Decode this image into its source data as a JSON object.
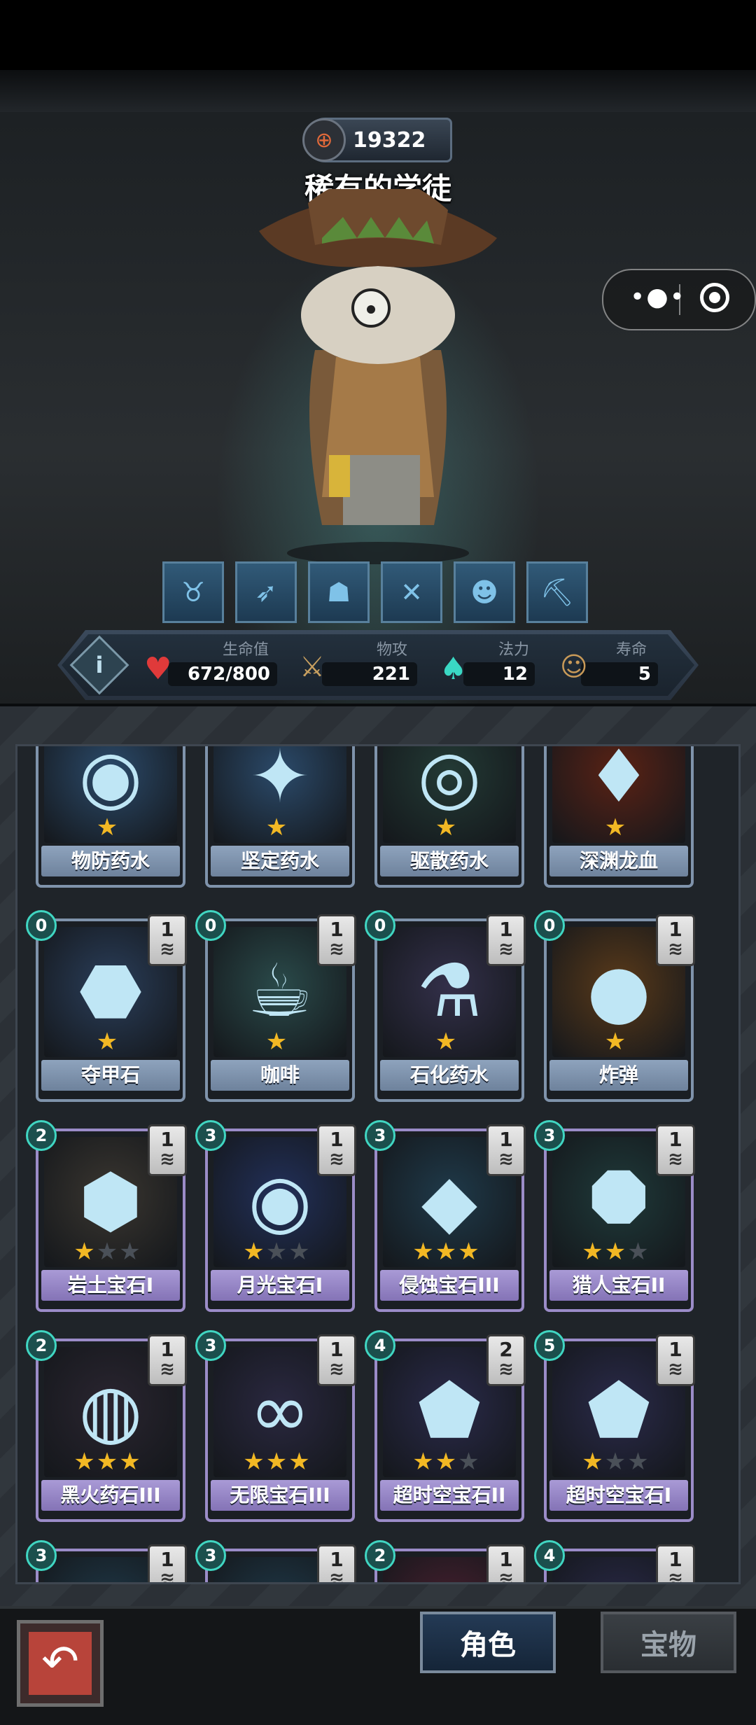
{
  "character": {
    "power": "19322",
    "name": "稀有的学徒"
  },
  "skill_icons": [
    "ox-icon",
    "bow-icon",
    "ghost-icon",
    "crossed-pistols-icon",
    "demon-mask-icon",
    "pickaxe-icon"
  ],
  "stats": {
    "hp_label": "生命值",
    "hp_value": "672/800",
    "atk_label": "物攻",
    "atk_value": "221",
    "mana_label": "法力",
    "mana_value": "12",
    "life_label": "寿命",
    "life_value": "5"
  },
  "cards": [
    {
      "name": "物防药水",
      "cost": "",
      "count": "",
      "stars": 1,
      "max_stars": 1,
      "color": "#2b4a6a",
      "symbol": "◉",
      "tier": "blue"
    },
    {
      "name": "坚定药水",
      "cost": "",
      "count": "",
      "stars": 1,
      "max_stars": 1,
      "color": "#2b4a6a",
      "symbol": "✦",
      "tier": "blue"
    },
    {
      "name": "驱散药水",
      "cost": "",
      "count": "",
      "stars": 1,
      "max_stars": 1,
      "color": "#233a35",
      "symbol": "◎",
      "tier": "blue"
    },
    {
      "name": "深渊龙血",
      "cost": "",
      "count": "",
      "stars": 1,
      "max_stars": 1,
      "color": "#5a2215",
      "symbol": "♦",
      "tier": "blue"
    },
    {
      "name": "夺甲石",
      "cost": "0",
      "count": "1",
      "stars": 1,
      "max_stars": 1,
      "color": "#2a3e5a",
      "symbol": "⬣",
      "tier": "blue"
    },
    {
      "name": "咖啡",
      "cost": "0",
      "count": "1",
      "stars": 1,
      "max_stars": 1,
      "color": "#2a4a4a",
      "symbol": "☕",
      "tier": "blue"
    },
    {
      "name": "石化药水",
      "cost": "0",
      "count": "1",
      "stars": 1,
      "max_stars": 1,
      "color": "#33304a",
      "symbol": "⚗",
      "tier": "blue"
    },
    {
      "name": "炸弹",
      "cost": "0",
      "count": "1",
      "stars": 1,
      "max_stars": 1,
      "color": "#5a3a1a",
      "symbol": "●",
      "tier": "blue"
    },
    {
      "name": "岩土宝石I",
      "cost": "2",
      "count": "1",
      "stars": 1,
      "max_stars": 3,
      "color": "#3a3630",
      "symbol": "⬢",
      "tier": "purple"
    },
    {
      "name": "月光宝石I",
      "cost": "3",
      "count": "1",
      "stars": 1,
      "max_stars": 3,
      "color": "#22305a",
      "symbol": "◉",
      "tier": "purple"
    },
    {
      "name": "侵蚀宝石III",
      "cost": "3",
      "count": "1",
      "stars": 3,
      "max_stars": 3,
      "color": "#1f3a4a",
      "symbol": "◆",
      "tier": "purple"
    },
    {
      "name": "猎人宝石II",
      "cost": "3",
      "count": "1",
      "stars": 2,
      "max_stars": 3,
      "color": "#1f3a3a",
      "symbol": "⯃",
      "tier": "purple"
    },
    {
      "name": "黑火药石III",
      "cost": "2",
      "count": "1",
      "stars": 3,
      "max_stars": 3,
      "color": "#2a2530",
      "symbol": "◍",
      "tier": "purple"
    },
    {
      "name": "无限宝石III",
      "cost": "3",
      "count": "1",
      "stars": 3,
      "max_stars": 3,
      "color": "#2a2840",
      "symbol": "∞",
      "tier": "purple"
    },
    {
      "name": "超时空宝石II",
      "cost": "4",
      "count": "2",
      "stars": 2,
      "max_stars": 3,
      "color": "#2a2a4a",
      "symbol": "⬟",
      "tier": "purple"
    },
    {
      "name": "超时空宝石I",
      "cost": "5",
      "count": "1",
      "stars": 1,
      "max_stars": 3,
      "color": "#2a2a4a",
      "symbol": "⬟",
      "tier": "purple"
    },
    {
      "name": "",
      "cost": "3",
      "count": "1",
      "stars": 0,
      "max_stars": 0,
      "color": "#1f3a4a",
      "symbol": "",
      "tier": "purple"
    },
    {
      "name": "",
      "cost": "3",
      "count": "1",
      "stars": 0,
      "max_stars": 0,
      "color": "#1f3a4a",
      "symbol": "",
      "tier": "purple"
    },
    {
      "name": "",
      "cost": "2",
      "count": "1",
      "stars": 0,
      "max_stars": 0,
      "color": "#4a2030",
      "symbol": "",
      "tier": "purple"
    },
    {
      "name": "",
      "cost": "4",
      "count": "1",
      "stars": 0,
      "max_stars": 0,
      "color": "#2a2a4a",
      "symbol": "",
      "tier": "purple"
    }
  ],
  "tabs": {
    "active": "角色",
    "inactive": "宝物"
  },
  "colors": {
    "star_on": "#f2b824",
    "star_off": "#4a5058",
    "mana_ring": "#40d6c2"
  }
}
